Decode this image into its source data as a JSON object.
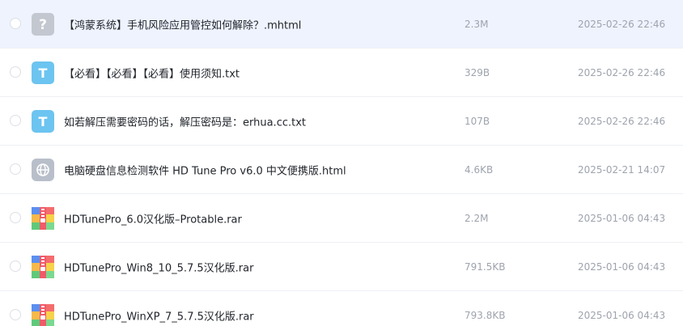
{
  "files": [
    {
      "name": "【鸿蒙系统】手机风险应用管控如何解除？.mhtml",
      "size": "2.3M",
      "date": "2025-02-26 22:46",
      "icon": "unknown-file-icon",
      "hovered": true
    },
    {
      "name": "【必看】【必看】【必看】使用须知.txt",
      "size": "329B",
      "date": "2025-02-26 22:46",
      "icon": "text-file-icon",
      "hovered": false
    },
    {
      "name": "如若解压需要密码的话，解压密码是：erhua.cc.txt",
      "size": "107B",
      "date": "2025-02-26 22:46",
      "icon": "text-file-icon",
      "hovered": false
    },
    {
      "name": "电脑硬盘信息检测软件 HD Tune Pro v6.0 中文便携版.html",
      "size": "4.6KB",
      "date": "2025-02-21 14:07",
      "icon": "web-file-icon",
      "hovered": false
    },
    {
      "name": "HDTunePro_6.0汉化版–Protable.rar",
      "size": "2.2M",
      "date": "2025-01-06 04:43",
      "icon": "archive-file-icon",
      "hovered": false
    },
    {
      "name": "HDTunePro_Win8_10_5.7.5汉化版.rar",
      "size": "791.5KB",
      "date": "2025-01-06 04:43",
      "icon": "archive-file-icon",
      "hovered": false
    },
    {
      "name": "HDTunePro_WinXP_7_5.7.5汉化版.rar",
      "size": "793.8KB",
      "date": "2025-01-06 04:43",
      "icon": "archive-file-icon",
      "hovered": false
    }
  ],
  "colors": {
    "hover_bg": "#eef3fe",
    "text_primary": "#1f2329",
    "text_secondary": "#9ea3ad",
    "unknown_icon": "#c3c7cf",
    "text_icon": "#6cc4f0",
    "web_icon": "#b9bfca"
  }
}
